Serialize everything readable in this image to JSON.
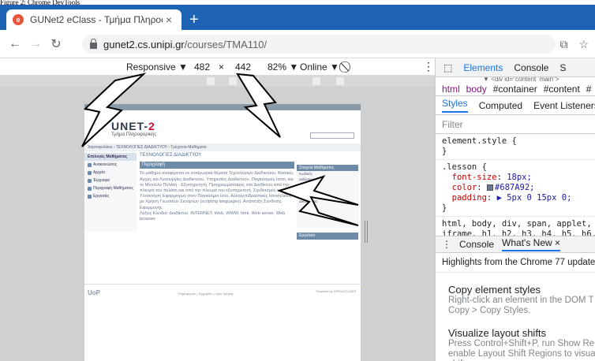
{
  "caption": "Figure 2: Chrome DevTools",
  "browser": {
    "tab_title": "GUNet2 eClass - Τμήμα Πληροφ",
    "url_host": "gunet2.cs.unipi.gr",
    "url_path": "/courses/TMA110/"
  },
  "device_toolbar": {
    "mode": "Responsive ▼",
    "width": "482",
    "times": "×",
    "height": "442",
    "zoom": "82% ▼",
    "network": "Online ▼"
  },
  "site": {
    "logo_text": "UNET-",
    "logo_e": "2",
    "subtitle": "Τμήμα Πληροφορικής",
    "breadcrumbs": "Χαρτοφυλάκιο › ΤΕΧΝΟΛΟΓΙΕΣ ΔΙΑΔΙΚΤΥΟΥ › Τρέχοντα Μαθήματα",
    "sidebar_header": "Επιλογές Μαθήματος",
    "sidebar_items": [
      "Ανακοινώσεις",
      "Αρχεία",
      "Έγγραφα",
      "Περιγραφή Μαθήματος",
      "Εργασίες"
    ],
    "course_title": "ΤΕΧΝΟΛΟΓΙΕΣ ΔΙΑΔΙΚΤΥΟΥ",
    "box_title": "Περιγραφή",
    "description": "Το μάθημα αναφέρεται σε εισαγωγικά θέματα Τεχνολογιών Διαδικτύου. Βασικές Αρχές και Λειτουργίες Διαδικτύου. Υπηρεσίες Διαδικτύου. Παγκόσμιος Ιστός και το Μοντέλο Πελάτη - Εξυπηρετητή. Προγραμματισμός στο Διαδίκτυο από την πλευρά του πελάτη και από την πλευρά του εξυπηρετητή. Σχεδιασμός και Υλοποίηση Εφαρμογών στον Παγκόσμιο Ιστό. Αλληλεπιδραστικές Ιστοσελίδες με Χρήση Γλωσσών Σεναρίων (scripting languages). Ανάπτυξη Σύνθετης Εφαρμογής.",
    "keywords": "Λέξεις Κλειδιά: Διαδίκτυο, INTERNET, Web, WWW, html, Web server, Web browser",
    "right_header": "Στοιχεία Μαθήματος",
    "right_lines": [
      "Κωδικός",
      "Διδάσκων",
      "Τύπος",
      "Γλώσσα",
      "Ημερομηνία",
      "Δικαιώματα"
    ],
    "right2_header": "Εργαλεία",
    "footer_left": "UoP",
    "footer_mid": "Πληροφορίες | Εγχειρίδιο | Όροι Χρήσης",
    "footer_right": "Powered by OPEN ECLASS"
  },
  "devtools": {
    "tabs": [
      "Elements",
      "Console",
      "S"
    ],
    "crumb_line": "▼ <div id=\"content_main\">",
    "crumbs": [
      "html",
      "body",
      "#container",
      "#content",
      "#"
    ],
    "subtabs": [
      "Styles",
      "Computed",
      "Event Listeners"
    ],
    "filter_placeholder": "Filter",
    "rule1_selector": "element.style {",
    "rule1_close": "}",
    "rule2_selector": ".lesson {",
    "rule2_p1": "font-size",
    "rule2_v1": "18px;",
    "rule2_p2": "color",
    "rule2_v2": "#687A92;",
    "rule2_p3": "padding",
    "rule2_v3": "▶ 5px 0 15px 0;",
    "rule2_close": "}",
    "rule3_selector": "html, body, div, span, applet, obj",
    "rule3_more": "iframe, h1, h2, h3, h4, h5, h6, p",
    "drawer_console": "Console",
    "drawer_new": "What's New ×",
    "highlights": "Highlights from the Chrome 77 update",
    "news": [
      {
        "title": "Copy element styles",
        "body1": "Right-click an element in the DOM T",
        "body2": "Copy > Copy Styles."
      },
      {
        "title": "Visualize layout shifts",
        "body1": "Press Control+Shift+P, run Show Re",
        "body2": "enable Layout Shift Regions to visua",
        "body3": "shifts"
      }
    ]
  }
}
